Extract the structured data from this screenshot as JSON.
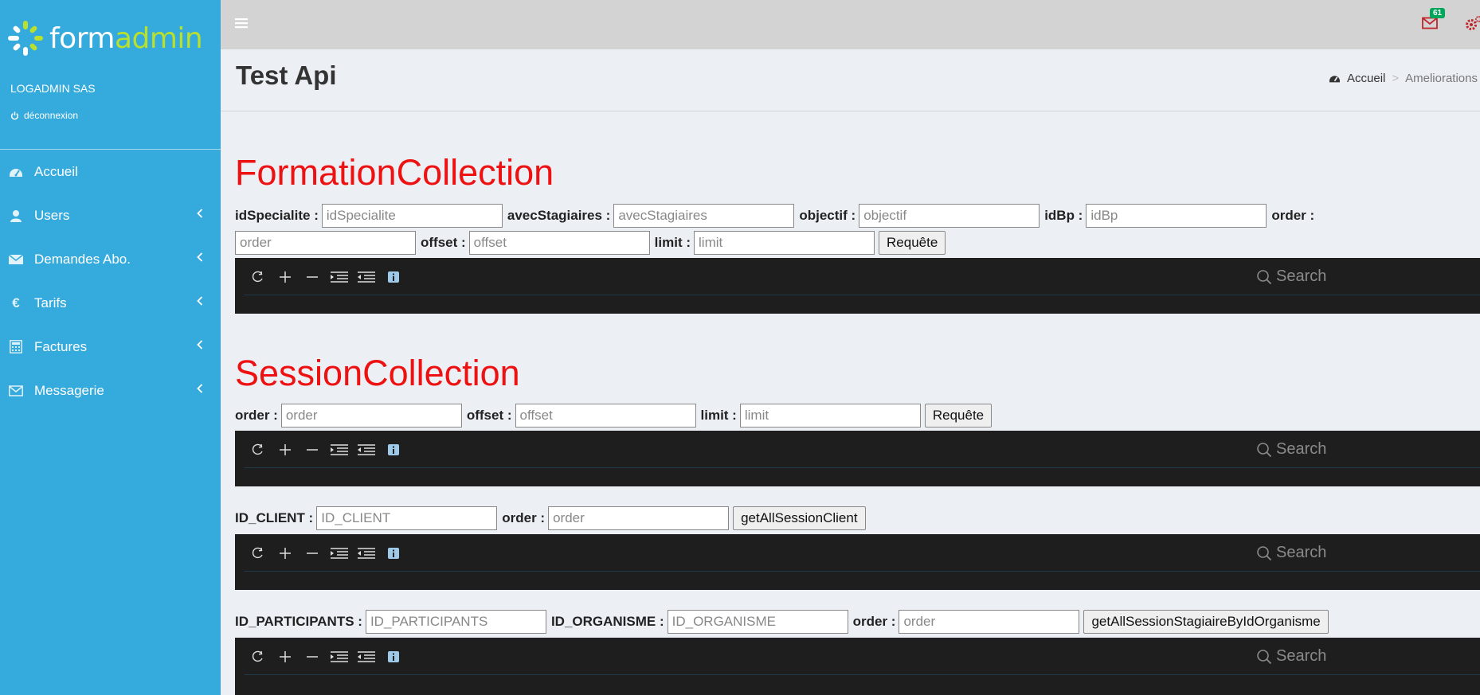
{
  "sidebar": {
    "logo_form": "form",
    "logo_admin": "admin",
    "company": "LOGADMIN SAS",
    "logout_label": "déconnexion",
    "items": [
      {
        "label": "Accueil",
        "icon": "dashboard-icon",
        "chevron": false
      },
      {
        "label": "Users",
        "icon": "user-icon",
        "chevron": true
      },
      {
        "label": "Demandes Abo.",
        "icon": "envelope-icon",
        "chevron": true
      },
      {
        "label": "Tarifs",
        "icon": "euro-icon",
        "chevron": true
      },
      {
        "label": "Factures",
        "icon": "calculator-icon",
        "chevron": true
      },
      {
        "label": "Messagerie",
        "icon": "envelope-outline-icon",
        "chevron": true
      }
    ]
  },
  "topbar": {
    "mail_count": "61"
  },
  "header": {
    "title": "Test Api",
    "breadcrumb_home": "Accueil",
    "breadcrumb_sep": ">",
    "breadcrumb_current": "Ameliorations"
  },
  "formation": {
    "title": "FormationCollection",
    "labels": {
      "idSpecialite": "idSpecialite :",
      "avecStagiaires": "avecStagiaires :",
      "objectif": "objectif :",
      "idBp": "idBp :",
      "order": "order :",
      "offset": "offset :",
      "limit": "limit :"
    },
    "placeholders": {
      "idSpecialite": "idSpecialite",
      "avecStagiaires": "avecStagiaires",
      "objectif": "objectif",
      "idBp": "idBp",
      "order": "order",
      "offset": "offset",
      "limit": "limit"
    },
    "button": "Requête"
  },
  "session": {
    "title": "SessionCollection",
    "labels": {
      "order": "order :",
      "offset": "offset :",
      "limit": "limit :"
    },
    "placeholders": {
      "order": "order",
      "offset": "offset",
      "limit": "limit"
    },
    "button": "Requête"
  },
  "client": {
    "labels": {
      "id_client": "ID_CLIENT :",
      "order": "order :"
    },
    "placeholders": {
      "id_client": "ID_CLIENT",
      "order": "order"
    },
    "button": "getAllSessionClient"
  },
  "participants": {
    "labels": {
      "id_participants": "ID_PARTICIPANTS :",
      "id_organisme": "ID_ORGANISME :",
      "order": "order :"
    },
    "placeholders": {
      "id_participants": "ID_PARTICIPANTS",
      "id_organisme": "ID_ORGANISME",
      "order": "order"
    },
    "button": "getAllSessionStagiaireByIdOrganisme"
  },
  "viewer": {
    "search_placeholder": "Search"
  }
}
